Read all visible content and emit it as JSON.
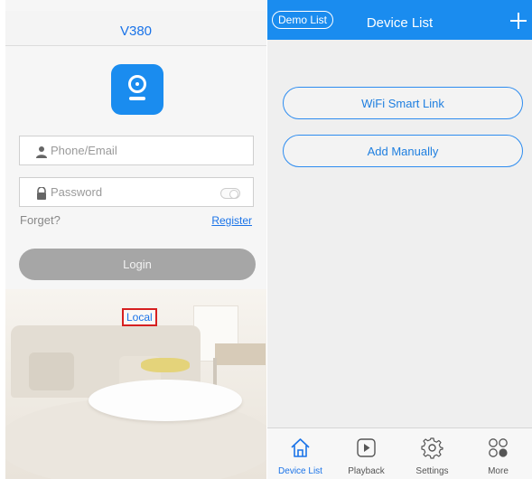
{
  "login": {
    "title": "V380",
    "phone_placeholder": "Phone/Email",
    "password_placeholder": "Password",
    "forget_label": "Forget?",
    "register_label": "Register",
    "login_label": "Login",
    "local_label": "Local"
  },
  "device_list": {
    "demo_label": "Demo List",
    "title": "Device List",
    "wifi_label": "WiFi Smart Link",
    "manual_label": "Add Manually"
  },
  "tabs": [
    {
      "label": "Device List",
      "icon": "home-icon",
      "active": true
    },
    {
      "label": "Playback",
      "icon": "play-icon",
      "active": false
    },
    {
      "label": "Settings",
      "icon": "gear-icon",
      "active": false
    },
    {
      "label": "More",
      "icon": "grid-icon",
      "active": false
    }
  ],
  "colors": {
    "accent": "#1a8cef",
    "login_button": "#a6a6a6",
    "highlight_box": "#d62020"
  }
}
